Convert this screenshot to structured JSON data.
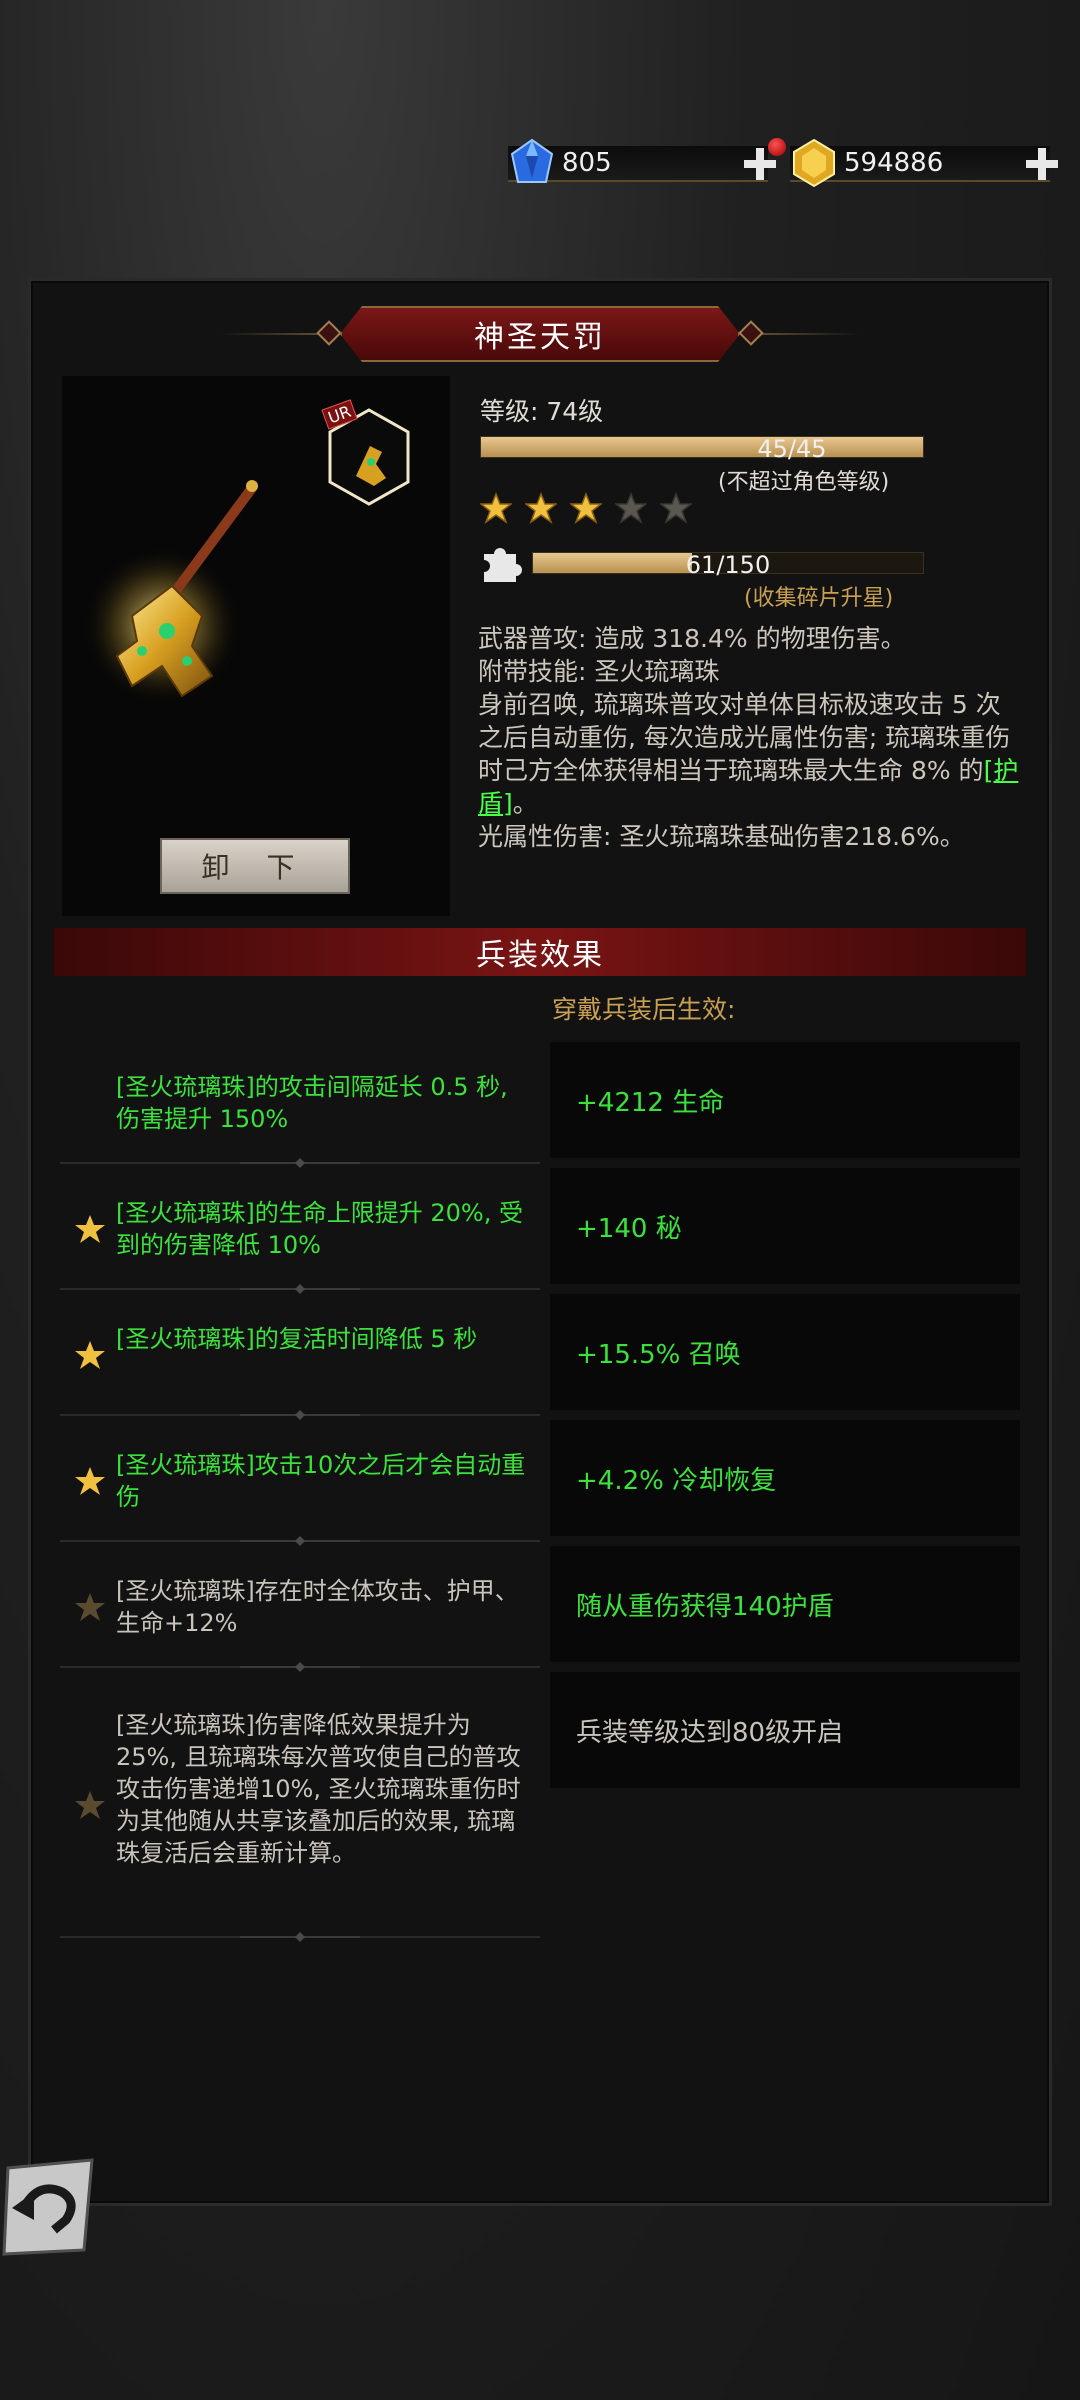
{
  "currencies": {
    "gems": "805",
    "gold": "594886"
  },
  "weapon": {
    "name": "神圣天罚",
    "rarity_badge": "UR",
    "level_label": "等级: 74级",
    "exp": {
      "text": "45/45",
      "fraction": 1.0,
      "note": "(不超过角色等级)"
    },
    "stars": {
      "filled": 3,
      "total": 5
    },
    "fragments": {
      "text": "61/150",
      "fraction": 0.4067,
      "note": "(收集碎片升星)"
    },
    "unequip_label": "卸 下",
    "description": {
      "part1": "武器普攻: 造成 318.4% 的物理伤害。\n附带技能: 圣火琉璃珠\n身前召唤, 琉璃珠普攻对单体目标极速攻击 5 次之后自动重伤, 每次造成光属性伤害; 琉璃珠重伤时己方全体获得相当于琉璃珠最大生命 8% 的",
      "link": "[护盾]",
      "part2": "。\n光属性伤害: 圣火琉璃珠基础伤害218.6%。"
    }
  },
  "effects": {
    "header": "兵装效果",
    "subheader": "穿戴兵装后生效:",
    "rows": [
      {
        "text": "[圣火琉璃珠]的攻击间隔延长 0.5 秒, 伤害提升 150%",
        "active": true,
        "star": "none"
      },
      {
        "text": "[圣火琉璃珠]的生命上限提升 20%, 受到的伤害降低 10%",
        "active": true,
        "star": "gold"
      },
      {
        "text": "[圣火琉璃珠]的复活时间降低 5 秒",
        "active": true,
        "star": "gold"
      },
      {
        "text": "[圣火琉璃珠]攻击10次之后才会自动重伤",
        "active": true,
        "star": "gold"
      },
      {
        "text": "[圣火琉璃珠]存在时全体攻击、护甲、生命+12%",
        "active": false,
        "star": "dim"
      },
      {
        "text": "[圣火琉璃珠]伤害降低效果提升为 25%, 且琉璃珠每次普攻使自己的普攻攻击伤害递增10%, 圣火琉璃珠重伤时为其他随从共享该叠加后的效果, 琉璃珠复活后会重新计算。",
        "active": false,
        "star": "dim"
      }
    ],
    "bonuses": [
      {
        "text": "+4212 生命",
        "active": true
      },
      {
        "text": "+140 秘",
        "active": true
      },
      {
        "text": "+15.5% 召唤",
        "active": true
      },
      {
        "text": "+4.2% 冷却恢复",
        "active": true
      },
      {
        "text": "随从重伤获得140护盾",
        "active": true
      },
      {
        "text": "兵装等级达到80级开启",
        "active": false
      }
    ]
  },
  "colors": {
    "active_text": "#3ce23c",
    "inactive_text": "#c8c4bc",
    "accent_gold": "#c8a050",
    "banner_red": "#7a1414"
  }
}
